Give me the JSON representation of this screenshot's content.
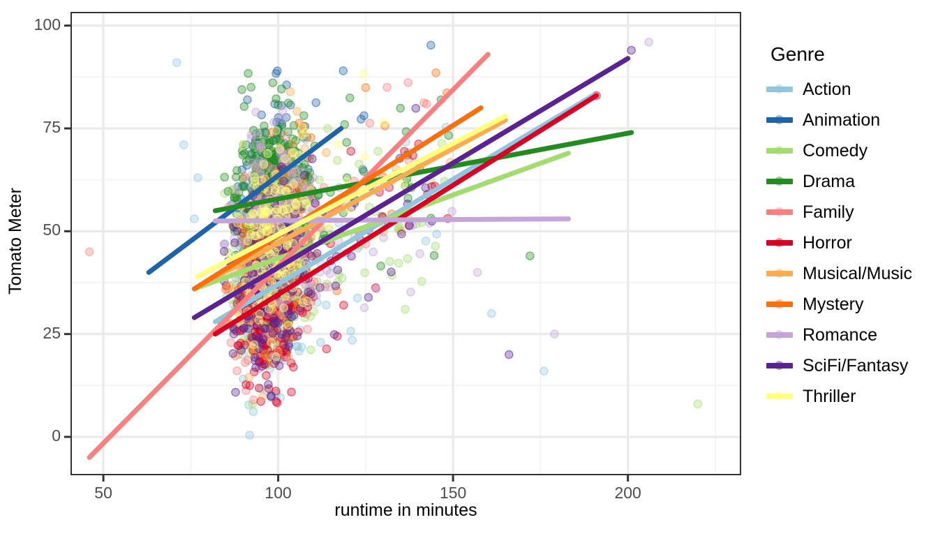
{
  "chart_data": {
    "type": "scatter",
    "title": "",
    "xlabel": "runtime in minutes",
    "ylabel": "Tomato Meter",
    "xlim": [
      41,
      232
    ],
    "ylim": [
      -9,
      103
    ],
    "xticks": [
      50,
      100,
      150,
      200
    ],
    "yticks": [
      0,
      25,
      50,
      75,
      100
    ],
    "xminor": [
      75,
      125,
      175,
      225
    ],
    "yminor": [
      12.5,
      37.5,
      62.5,
      87.5
    ],
    "grid": true,
    "legend_title": "Genre",
    "legend_position": "right",
    "point_opacity": 0.35,
    "series": [
      {
        "name": "Action",
        "color": "#92c5de",
        "trend": {
          "x0": 82,
          "y0": 28,
          "x1": 190,
          "y1": 83
        },
        "n_points": 260
      },
      {
        "name": "Animation",
        "color": "#1f63a8",
        "trend": {
          "x0": 63,
          "y0": 40,
          "x1": 118,
          "y1": 75
        },
        "n_points": 120
      },
      {
        "name": "Comedy",
        "color": "#a5dc72",
        "trend": {
          "x0": 76,
          "y0": 36,
          "x1": 183,
          "y1": 69
        },
        "n_points": 420
      },
      {
        "name": "Drama",
        "color": "#238b22",
        "trend": {
          "x0": 82,
          "y0": 55,
          "x1": 201,
          "y1": 74
        },
        "n_points": 430
      },
      {
        "name": "Family",
        "color": "#f98080",
        "trend": {
          "x0": 46,
          "y0": -5,
          "x1": 160,
          "y1": 93
        },
        "n_points": 150
      },
      {
        "name": "Horror",
        "color": "#d80024",
        "trend": {
          "x0": 82,
          "y0": 25,
          "x1": 191,
          "y1": 83
        },
        "n_points": 250
      },
      {
        "name": "Musical/Music",
        "color": "#fbab52",
        "trend": {
          "x0": 78,
          "y0": 37,
          "x1": 165,
          "y1": 77
        },
        "n_points": 120
      },
      {
        "name": "Mystery",
        "color": "#fb700e",
        "trend": {
          "x0": 76,
          "y0": 36,
          "x1": 158,
          "y1": 80
        },
        "n_points": 130
      },
      {
        "name": "Romance",
        "color": "#c4a5d8",
        "trend": {
          "x0": 82,
          "y0": 52.5,
          "x1": 183,
          "y1": 53
        },
        "n_points": 230
      },
      {
        "name": "SciFi/Fantasy",
        "color": "#5a2391",
        "trend": {
          "x0": 76,
          "y0": 29,
          "x1": 200,
          "y1": 92
        },
        "n_points": 250
      },
      {
        "name": "Thriller",
        "color": "#ffff80",
        "trend": {
          "x0": 77,
          "y0": 39,
          "x1": 165,
          "y1": 78
        },
        "n_points": 200
      }
    ],
    "outlier_points": [
      {
        "x": 46,
        "y": 45,
        "series": "Family"
      },
      {
        "x": 220,
        "y": 8,
        "series": "Comedy"
      },
      {
        "x": 206,
        "y": 96,
        "series": "Romance"
      },
      {
        "x": 201,
        "y": 94,
        "series": "SciFi/Fantasy"
      },
      {
        "x": 191,
        "y": 83,
        "series": "Horror"
      },
      {
        "x": 176,
        "y": 16,
        "series": "Action"
      },
      {
        "x": 179,
        "y": 25,
        "series": "Romance"
      },
      {
        "x": 172,
        "y": 44,
        "series": "Drama"
      },
      {
        "x": 166,
        "y": 20,
        "series": "SciFi/Fantasy"
      },
      {
        "x": 161,
        "y": 30,
        "series": "Action"
      },
      {
        "x": 157,
        "y": 40,
        "series": "Romance"
      },
      {
        "x": 71,
        "y": 91,
        "series": "Action"
      },
      {
        "x": 77,
        "y": 63,
        "series": "Action"
      },
      {
        "x": 76,
        "y": 53,
        "series": "Action"
      },
      {
        "x": 73,
        "y": 71,
        "series": "Action"
      }
    ]
  },
  "axis": {
    "x_title": "runtime in minutes",
    "y_title": "Tomato Meter",
    "x_tick_labels": [
      "50",
      "100",
      "150",
      "200"
    ],
    "y_tick_labels": [
      "0",
      "25",
      "50",
      "75",
      "100"
    ]
  },
  "legend": {
    "title": "Genre",
    "items": [
      {
        "label": "Action",
        "color": "#92c5de"
      },
      {
        "label": "Animation",
        "color": "#1f63a8"
      },
      {
        "label": "Comedy",
        "color": "#a5dc72"
      },
      {
        "label": "Drama",
        "color": "#238b22"
      },
      {
        "label": "Family",
        "color": "#f98080"
      },
      {
        "label": "Horror",
        "color": "#d80024"
      },
      {
        "label": "Musical/Music",
        "color": "#fbab52"
      },
      {
        "label": "Mystery",
        "color": "#fb700e"
      },
      {
        "label": "Romance",
        "color": "#c4a5d8"
      },
      {
        "label": "SciFi/Fantasy",
        "color": "#5a2391"
      },
      {
        "label": "Thriller",
        "color": "#ffff80"
      }
    ]
  },
  "theme": {
    "panel_border": "#333333",
    "grid_major": "#ebebeb",
    "grid_minor": "#f4f4f4",
    "tick_text": "#4d4d4d",
    "title_text": "#000000",
    "background": "#ffffff"
  }
}
